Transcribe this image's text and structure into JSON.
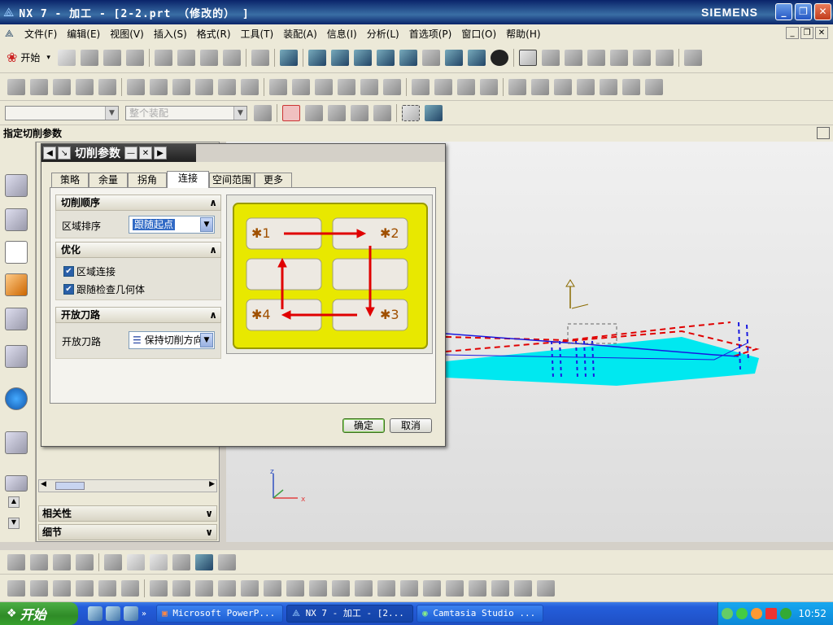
{
  "window": {
    "title": "NX 7 - 加工 - [2-2.prt （修改的） ]",
    "brand": "SIEMENS"
  },
  "menu": [
    "文件(F)",
    "编辑(E)",
    "视图(V)",
    "插入(S)",
    "格式(R)",
    "工具(T)",
    "装配(A)",
    "信息(I)",
    "分析(L)",
    "首选项(P)",
    "窗口(O)",
    "帮助(H)"
  ],
  "toolbar": {
    "start_label": "开始",
    "filter_value": "",
    "assembly_scope": "整个装配"
  },
  "cue_line": "指定切削参数",
  "dialog": {
    "title": "切削参数",
    "tabs": [
      "策略",
      "余量",
      "拐角",
      "连接",
      "空间范围",
      "更多"
    ],
    "active_tab": "连接",
    "groups": {
      "cut_order": {
        "header": "切削顺序",
        "region_sort_label": "区域排序",
        "region_sort_value": "跟随起点"
      },
      "optimization": {
        "header": "优化",
        "region_connect": "区域连接",
        "follow_check_geometry": "跟随检查几何体"
      },
      "open_path": {
        "header": "开放刀路",
        "label": "开放刀路",
        "value": "保持切削方向"
      }
    },
    "illustration": {
      "labels": [
        "✱1",
        "✱2",
        "✱4",
        "✱3"
      ]
    },
    "ok": "确定",
    "cancel": "取消"
  },
  "nav_panel": {
    "sections": [
      "相关性",
      "细节"
    ]
  },
  "axes": {
    "small_x": "x",
    "small_z": "z"
  },
  "taskbar": {
    "start": "开始",
    "tasks": [
      "Microsoft PowerP...",
      "NX 7 - 加工 - [2...",
      "Camtasia Studio ..."
    ],
    "clock": "10:52"
  },
  "colors": {
    "accent": "#245edb",
    "toolpath_red": "#e00000",
    "toolpath_blue": "#1a1ae0",
    "part_cyan": "#00e8f0",
    "illustration_yellow": "#e8e800"
  }
}
